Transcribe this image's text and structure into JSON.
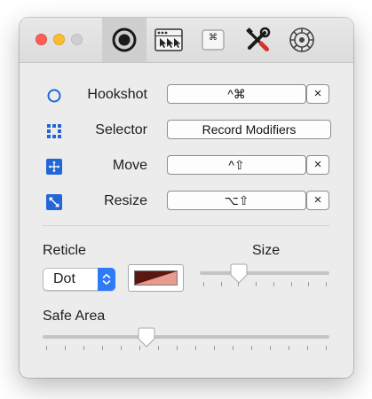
{
  "toolbar": {
    "tabs": [
      {
        "name": "reticle-tab-icon",
        "active": true
      },
      {
        "name": "windows-tab-icon",
        "active": false
      },
      {
        "name": "shortcut-tab-icon",
        "active": false
      },
      {
        "name": "tools-tab-icon",
        "active": false
      },
      {
        "name": "advanced-tab-icon",
        "active": false
      }
    ]
  },
  "shortcuts": {
    "hookshot": {
      "label": "Hookshot",
      "value": "^⌘",
      "clear": "×"
    },
    "selector": {
      "label": "Selector",
      "value": "Record Modifiers"
    },
    "move": {
      "label": "Move",
      "value": "^⇧",
      "clear": "×"
    },
    "resize": {
      "label": "Resize",
      "value": "⌥⇧",
      "clear": "×"
    }
  },
  "reticle": {
    "label": "Reticle",
    "style_value": "Dot",
    "color_primary": "#5a1712",
    "color_secondary": "#e89a8c",
    "accent": "#2f7bf5"
  },
  "size": {
    "label": "Size",
    "value_fraction": 0.29,
    "tick_count": 8
  },
  "safe_area": {
    "label": "Safe Area",
    "value_fraction": 0.36,
    "tick_count": 16
  }
}
